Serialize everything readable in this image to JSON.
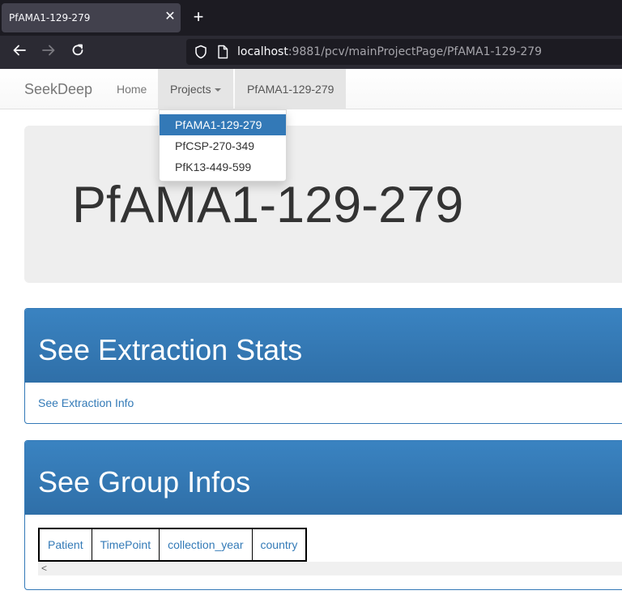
{
  "browser": {
    "tab_title": "PfAMA1-129-279",
    "close_glyph": "✕",
    "new_tab_glyph": "+",
    "url_host": "localhost",
    "url_rest": ":9881/pcv/mainProjectPage/PfAMA1-129-279",
    "icons": [
      "arrow-left-icon",
      "arrow-right-icon",
      "reload-icon",
      "shield-icon",
      "page-icon"
    ]
  },
  "navbar": {
    "brand": "SeekDeep",
    "home": "Home",
    "projects": "Projects",
    "current": "PfAMA1-129-279"
  },
  "dropdown": {
    "items": [
      "PfAMA1-129-279",
      "PfCSP-270-349",
      "PfK13-449-599"
    ],
    "selected_index": 0
  },
  "jumbotron": {
    "title": "PfAMA1-129-279"
  },
  "extraction": {
    "heading": "See Extraction Stats",
    "link": "See Extraction Info"
  },
  "group": {
    "heading": "See Group Infos",
    "columns": [
      "Patient",
      "TimePoint",
      "collection_year",
      "country"
    ],
    "scroll_glyph": "<"
  },
  "colors": {
    "primary": "#337ab7",
    "chrome_dark": "#1c1b22",
    "chrome_bar": "#2b2a33"
  }
}
